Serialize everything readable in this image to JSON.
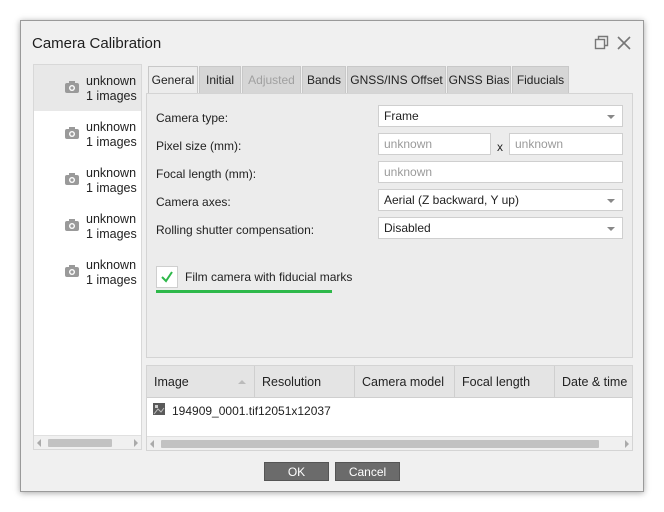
{
  "window": {
    "title": "Camera Calibration"
  },
  "cameras": [
    {
      "name": "unknown",
      "count": "1 images"
    },
    {
      "name": "unknown",
      "count": "1 images"
    },
    {
      "name": "unknown",
      "count": "1 images"
    },
    {
      "name": "unknown",
      "count": "1 images"
    },
    {
      "name": "unknown",
      "count": "1 images"
    }
  ],
  "tabs": [
    "General",
    "Initial",
    "Adjusted",
    "Bands",
    "GNSS/INS Offset",
    "GNSS Bias",
    "Fiducials"
  ],
  "general": {
    "camera_type_label": "Camera type:",
    "camera_type_value": "Frame",
    "pixel_size_label": "Pixel size (mm):",
    "pixel_size_x_placeholder": "unknown",
    "pixel_size_sep": "x",
    "pixel_size_y_placeholder": "unknown",
    "focal_length_label": "Focal length (mm):",
    "focal_length_placeholder": "unknown",
    "camera_axes_label": "Camera axes:",
    "camera_axes_value": "Aerial (Z backward, Y up)",
    "rolling_shutter_label": "Rolling shutter compensation:",
    "rolling_shutter_value": "Disabled",
    "film_camera_label": "Film camera with fiducial marks",
    "film_camera_checked": true
  },
  "image_table": {
    "columns": [
      "Image",
      "Resolution",
      "Camera model",
      "Focal length",
      "Date & time"
    ],
    "rows": [
      {
        "image": "194909_0001.tif",
        "resolution": "12051x12037"
      }
    ]
  },
  "buttons": {
    "ok": "OK",
    "cancel": "Cancel"
  },
  "colors": {
    "accent_green": "#2eb84a",
    "button_bg": "#6b6b6b"
  },
  "icons": {
    "camera": "camera-icon",
    "file": "image-file-icon",
    "restore": "restore-window-icon",
    "close": "close-icon",
    "check": "checkmark-icon"
  }
}
